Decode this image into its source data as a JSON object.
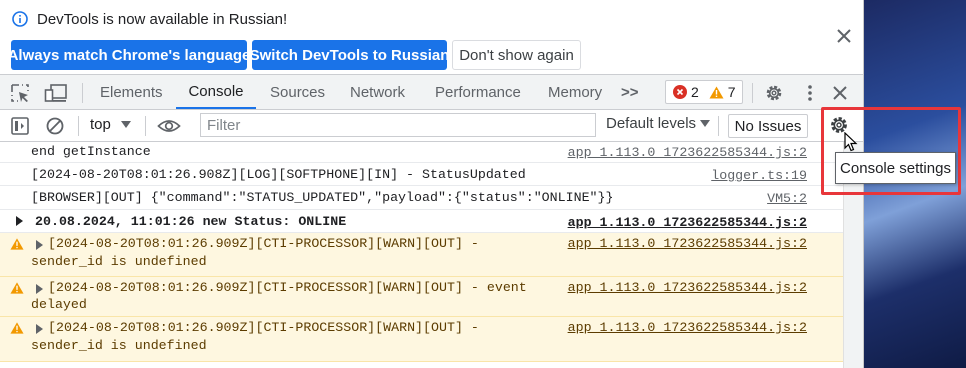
{
  "infobar": {
    "message": "DevTools is now available in Russian!",
    "btn_match": "Always match Chrome's language",
    "btn_switch": "Switch DevTools to Russian",
    "btn_dont": "Don't show again"
  },
  "tabs": {
    "items": [
      "Elements",
      "Console",
      "Sources",
      "Network",
      "Performance",
      "Memory"
    ],
    "active": "Console",
    "overflow": ">>",
    "errors": "2",
    "warnings": "7"
  },
  "console_toolbar": {
    "context": "top",
    "filter_placeholder": "Filter",
    "levels": "Default levels",
    "issues": "No Issues"
  },
  "rows": [
    {
      "type": "log",
      "text": "end getInstance",
      "source": "app_1.113.0_1723622585344.js:2"
    },
    {
      "type": "log",
      "text": "[2024-08-20T08:01:26.908Z][LOG][SOFTPHONE][IN] - StatusUpdated",
      "source": "logger.ts:19"
    },
    {
      "type": "log",
      "text": "[BROWSER][OUT] {\"command\":\"STATUS_UPDATED\",\"payload\":{\"status\":\"ONLINE\"}}",
      "source": "VM5:2"
    },
    {
      "type": "group",
      "text": "20.08.2024, 11:01:26 new Status: ONLINE",
      "source": "app_1.113.0_1723622585344.js:2"
    },
    {
      "type": "warn",
      "line1": "[2024-08-20T08:01:26.909Z][CTI-PROCESSOR][WARN][OUT] -",
      "line2": "sender_id is undefined",
      "source": "app_1.113.0_1723622585344.js:2"
    },
    {
      "type": "warn",
      "line1": "[2024-08-20T08:01:26.909Z][CTI-PROCESSOR][WARN][OUT] - event",
      "line2": "delayed",
      "source": "app_1.113.0_1723622585344.js:2"
    },
    {
      "type": "warn",
      "line1": "[2024-08-20T08:01:26.909Z][CTI-PROCESSOR][WARN][OUT] -",
      "line2": "sender_id is undefined",
      "source": "app_1.113.0_1723622585344.js:2"
    }
  ],
  "tooltip": "Console settings",
  "colors": {
    "accent": "#1a73e8",
    "error": "#d93025",
    "warning": "#f29900",
    "highlight": "#e8363a"
  },
  "icons": [
    "info-icon",
    "close-icon",
    "inspect-icon",
    "device-toggle-icon",
    "settings-icon",
    "kebab-menu-icon",
    "sidebar-icon",
    "clear-icon",
    "eye-icon",
    "gear-icon",
    "warning-icon",
    "cursor-icon"
  ]
}
